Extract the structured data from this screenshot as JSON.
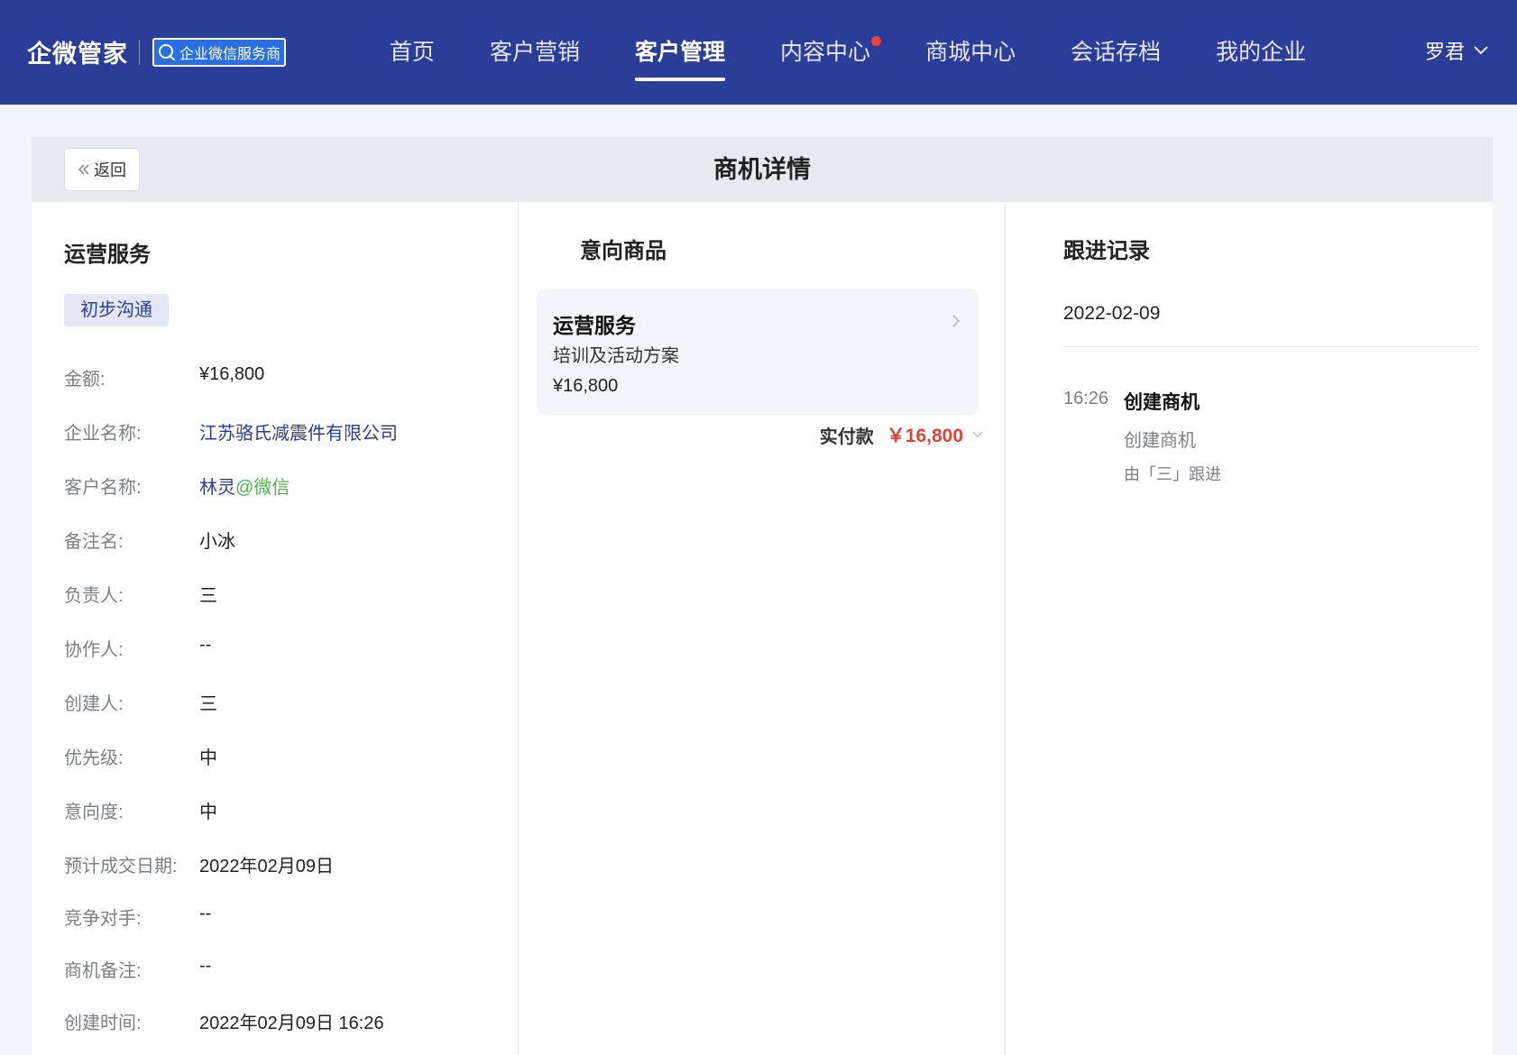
{
  "header": {
    "brand": "企微管家",
    "badge_text": "企业微信服务商",
    "nav": [
      {
        "label": "首页"
      },
      {
        "label": "客户营销"
      },
      {
        "label": "客户管理"
      },
      {
        "label": "内容中心"
      },
      {
        "label": "商城中心"
      },
      {
        "label": "会话存档"
      },
      {
        "label": "我的企业"
      }
    ],
    "active_nav": "客户管理",
    "user_name": "罗君"
  },
  "page": {
    "back_label": "返回",
    "title": "商机详情"
  },
  "detail": {
    "title": "运营服务",
    "stage": "初步沟通",
    "fields": [
      {
        "label": "金额:",
        "value": "¥16,800"
      },
      {
        "label": "企业名称:",
        "value": "江苏骆氏减震件有限公司"
      },
      {
        "label": "客户名称:",
        "value": "林灵",
        "suffix": "@微信"
      },
      {
        "label": "备注名:",
        "value": "小冰"
      },
      {
        "label": "负责人:",
        "value": "三"
      },
      {
        "label": "协作人:",
        "value": "--"
      },
      {
        "label": "创建人:",
        "value": "三"
      },
      {
        "label": "优先级:",
        "value": "中"
      },
      {
        "label": "意向度:",
        "value": "中"
      },
      {
        "label": "预计成交日期:",
        "value": "2022年02月09日"
      },
      {
        "label": "竞争对手:",
        "value": "--"
      },
      {
        "label": "商机备注:",
        "value": "--"
      },
      {
        "label": "创建时间:",
        "value": "2022年02月09日 16:26"
      }
    ]
  },
  "goods": {
    "title": "意向商品",
    "item": {
      "name": "运营服务",
      "desc": "培训及活动方案",
      "price": "¥16,800"
    },
    "paid_label": "实付款",
    "paid_amount": "￥16,800"
  },
  "followup": {
    "title": "跟进记录",
    "date": "2022-02-09",
    "record": {
      "time": "16:26",
      "title": "创建商机",
      "desc": "创建商机",
      "by": "由「三」跟进"
    }
  },
  "colors": {
    "header_bg": "#2b3d96",
    "accent": "#2b3d96",
    "price_red": "#e0433a",
    "wechat_green": "#4bb64b",
    "notify_dot": "#e84343"
  },
  "icons": {
    "brand_badge": "chat-bubble-icon",
    "user_menu": "chevron-down-icon",
    "back": "double-chevron-left-icon",
    "goods_card": "chevron-right-icon",
    "paid_toggle": "chevron-down-icon"
  }
}
